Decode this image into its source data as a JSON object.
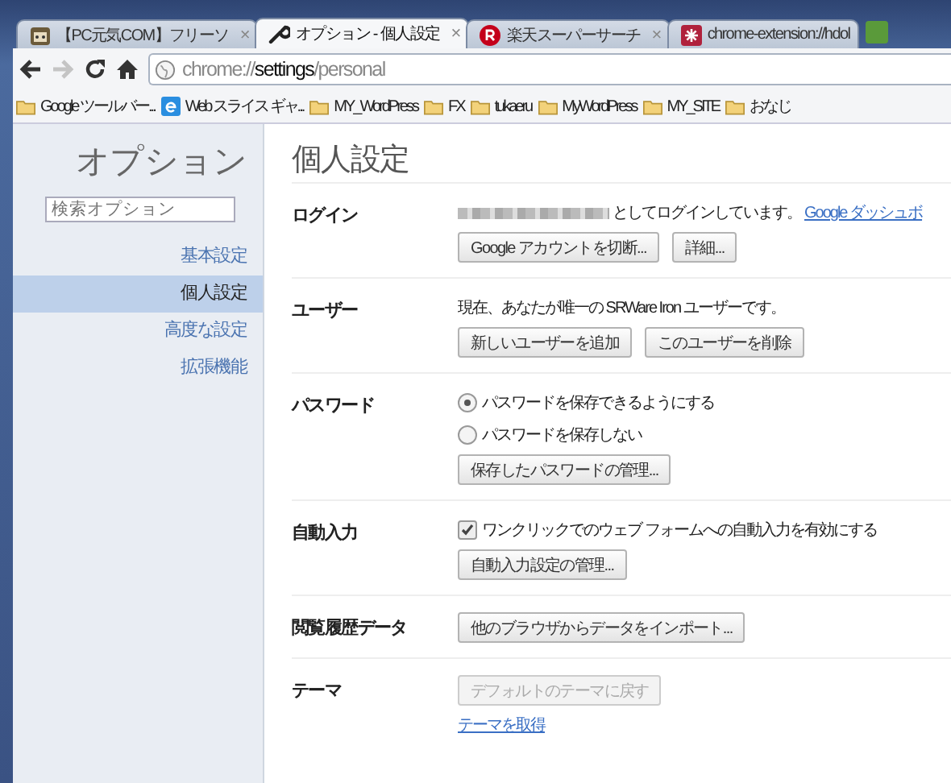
{
  "tabs": [
    {
      "title": "【PC元気COM】フリーソ",
      "selected": false,
      "close": "×"
    },
    {
      "title": "オプション - 個人設定",
      "selected": true,
      "close": "×"
    },
    {
      "title": "楽天スーパーサーチ",
      "selected": false,
      "close": "×"
    },
    {
      "title": "chrome-extension://hdol",
      "selected": false
    }
  ],
  "toolbar": {
    "forward_disabled": true,
    "url": {
      "scheme": "chrome://",
      "host": "settings",
      "path": "/personal"
    }
  },
  "bookmarks": [
    {
      "label": "Google ツールバー...",
      "kind": "folder"
    },
    {
      "label": "Web スライス ギャ...",
      "kind": "webslice"
    },
    {
      "label": "MY_WordPress",
      "kind": "folder"
    },
    {
      "label": "FX",
      "kind": "folder"
    },
    {
      "label": "tukaeru",
      "kind": "folder"
    },
    {
      "label": "MyWordPress",
      "kind": "folder"
    },
    {
      "label": "MY_SITE",
      "kind": "folder"
    },
    {
      "label": "おなじ",
      "kind": "folder"
    }
  ],
  "sidebar": {
    "title": "オプション",
    "search": {
      "placeholder": "検索オプション"
    },
    "items": [
      {
        "label": "基本設定",
        "selected": false
      },
      {
        "label": "個人設定",
        "selected": true
      },
      {
        "label": "高度な設定",
        "selected": false
      },
      {
        "label": "拡張機能",
        "selected": false
      }
    ]
  },
  "page": {
    "title": "個人設定",
    "sections": [
      {
        "label": "ログイン",
        "items": [
          {
            "kind": "login",
            "text": "としてログインしています。",
            "link": "Google ダッシュボ"
          },
          {
            "kind": "buttons",
            "buttons": [
              {
                "label": "Google アカウントを切断...",
                "disabled": false
              },
              {
                "label": "詳細...",
                "disabled": false
              }
            ]
          }
        ]
      },
      {
        "label": "ユーザー",
        "items": [
          {
            "kind": "text",
            "text": "現在、あなたが唯一の SRWare Iron ユーザーです。"
          },
          {
            "kind": "buttons",
            "buttons": [
              {
                "label": "新しいユーザーを追加",
                "disabled": false
              },
              {
                "label": "このユーザーを削除",
                "disabled": false
              }
            ]
          }
        ]
      },
      {
        "label": "パスワード",
        "items": [
          {
            "kind": "radio",
            "text": "パスワードを保存できるようにする",
            "selected": true
          },
          {
            "kind": "radio",
            "text": "パスワードを保存しない",
            "selected": false
          },
          {
            "kind": "buttons",
            "buttons": [
              {
                "label": "保存したパスワードの管理...",
                "disabled": false
              }
            ]
          }
        ]
      },
      {
        "label": "自動入力",
        "items": [
          {
            "kind": "checkbox",
            "text": "ワンクリックでのウェブ フォームへの自動入力を有効にする",
            "checked": true
          },
          {
            "kind": "buttons",
            "buttons": [
              {
                "label": "自動入力設定の管理...",
                "disabled": false
              }
            ]
          }
        ]
      },
      {
        "label": "閲覧履歴データ",
        "items": [
          {
            "kind": "buttons",
            "buttons": [
              {
                "label": "他のブラウザからデータをインポート...",
                "disabled": false
              }
            ]
          }
        ]
      },
      {
        "label": "テーマ",
        "items": [
          {
            "kind": "buttons",
            "buttons": [
              {
                "label": "デフォルトのテーマに戻す",
                "disabled": true
              }
            ]
          },
          {
            "kind": "link",
            "text": "テーマを取得"
          }
        ]
      }
    ]
  }
}
